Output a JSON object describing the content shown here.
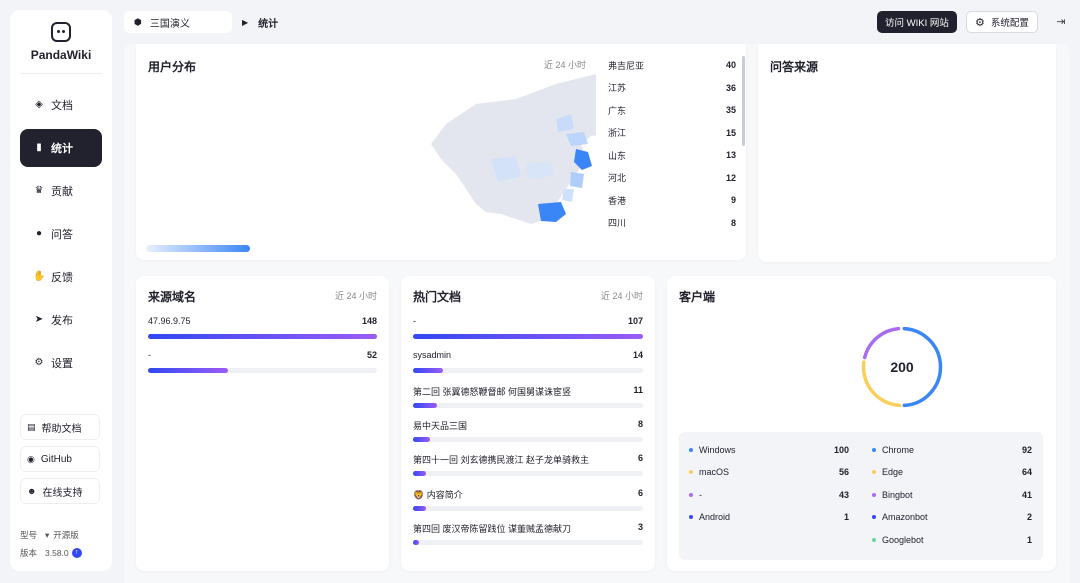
{
  "app": {
    "name": "PandaWiki"
  },
  "sidebar": {
    "items": [
      {
        "label": "文档",
        "icon": "layers-icon"
      },
      {
        "label": "统计",
        "icon": "bar-chart-icon",
        "active": true
      },
      {
        "label": "贡献",
        "icon": "trophy-icon"
      },
      {
        "label": "问答",
        "icon": "chat-bubble-icon"
      },
      {
        "label": "反馈",
        "icon": "hand-icon"
      },
      {
        "label": "发布",
        "icon": "send-icon"
      },
      {
        "label": "设置",
        "icon": "gear-icon"
      }
    ],
    "links": [
      {
        "label": "帮助文档",
        "icon": "doc-icon"
      },
      {
        "label": "GitHub",
        "icon": "github-icon"
      },
      {
        "label": "在线支持",
        "icon": "people-icon"
      }
    ],
    "model_label": "型号",
    "model_value": "开源版",
    "version_label": "版本",
    "version_value": "3.58.0"
  },
  "header": {
    "breadcrumb": "三国演义",
    "current": "统计",
    "visit_button": "访问 WIKI 网站",
    "settings_button": "系统配置"
  },
  "user_dist": {
    "title": "用户分布",
    "period": "近 24 小时",
    "provinces": [
      {
        "name": "弗吉尼亚",
        "value": "40"
      },
      {
        "name": "江苏",
        "value": "36"
      },
      {
        "name": "广东",
        "value": "35"
      },
      {
        "name": "浙江",
        "value": "15"
      },
      {
        "name": "山东",
        "value": "13"
      },
      {
        "name": "河北",
        "value": "12"
      },
      {
        "name": "香港",
        "value": "9"
      },
      {
        "name": "四川",
        "value": "8"
      }
    ]
  },
  "qa_source": {
    "title": "问答来源"
  },
  "source_domain": {
    "title": "来源域名",
    "period": "近 24 小时",
    "rows": [
      {
        "label": "47.96.9.75",
        "value": "148",
        "fraction": 1.0
      },
      {
        "label": "-",
        "value": "52",
        "fraction": 0.35
      }
    ]
  },
  "hot_docs": {
    "title": "热门文档",
    "period": "近 24 小时",
    "rows": [
      {
        "label": "-",
        "value": "107",
        "fraction": 1.0
      },
      {
        "label": "sysadmin",
        "value": "14",
        "fraction": 0.131
      },
      {
        "label": "第二回 张翼德怒鞭督邮 何国舅谋诛宦竖",
        "value": "11",
        "fraction": 0.103
      },
      {
        "label": "易中天品三国",
        "value": "8",
        "fraction": 0.075
      },
      {
        "label": "第四十一回 刘玄德携民渡江 赵子龙单骑救主",
        "value": "6",
        "fraction": 0.056
      },
      {
        "label": "🦁 内容简介",
        "value": "6",
        "fraction": 0.056
      },
      {
        "label": "第四回 废汉帝陈留践位 谋董贼孟德献刀",
        "value": "3",
        "fraction": 0.028
      }
    ]
  },
  "client": {
    "title": "客户端",
    "total": "200",
    "colors": {
      "blue": "#3b86f6",
      "yellow": "#f8cf5a",
      "purple": "#a86cf3",
      "navy": "#3248f2",
      "green": "#6fd4a4"
    },
    "os": [
      {
        "name": "Windows",
        "value": "100",
        "color": "#3b86f6"
      },
      {
        "name": "macOS",
        "value": "56",
        "color": "#f8cf5a"
      },
      {
        "name": "-",
        "value": "43",
        "color": "#a86cf3"
      },
      {
        "name": "Android",
        "value": "1",
        "color": "#3248f2"
      }
    ],
    "browsers": [
      {
        "name": "Chrome",
        "value": "92",
        "color": "#3b86f6"
      },
      {
        "name": "Edge",
        "value": "64",
        "color": "#f8cf5a"
      },
      {
        "name": "Bingbot",
        "value": "41",
        "color": "#a86cf3"
      },
      {
        "name": "Amazonbot",
        "value": "2",
        "color": "#3248f2"
      },
      {
        "name": "Googlebot",
        "value": "1",
        "color": "#6fd4a4"
      }
    ]
  }
}
